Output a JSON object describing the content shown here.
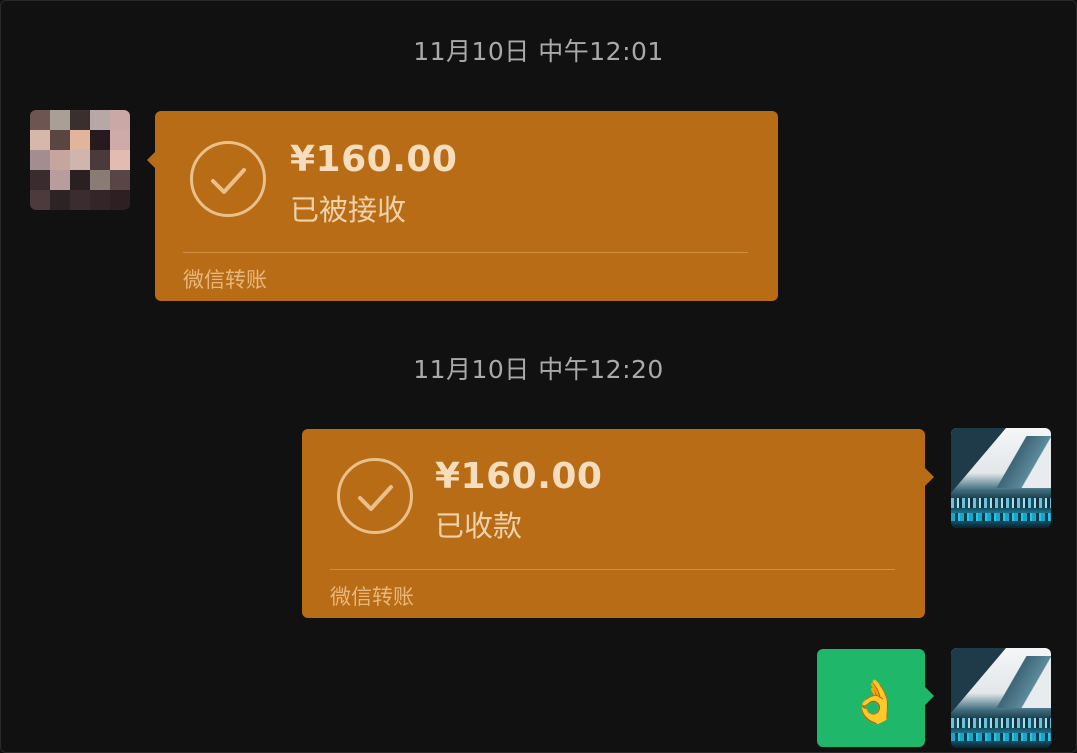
{
  "messages": {
    "time_1": "11月10日 中午12:01",
    "time_2": "11月10日 中午12:20",
    "transfer_in": {
      "amount": "¥160.00",
      "status": "已被接收",
      "footer": "微信转账"
    },
    "transfer_out": {
      "amount": "¥160.00",
      "status": "已收款",
      "footer": "微信转账"
    },
    "reply": {
      "emoji": "👌",
      "emoji_name": "ok-hand-icon"
    }
  },
  "colors": {
    "background": "#111111",
    "transfer_bubble": "#b86c16",
    "reply_bubble": "#1fb86a",
    "timestamp_text": "#a9a9a9"
  }
}
